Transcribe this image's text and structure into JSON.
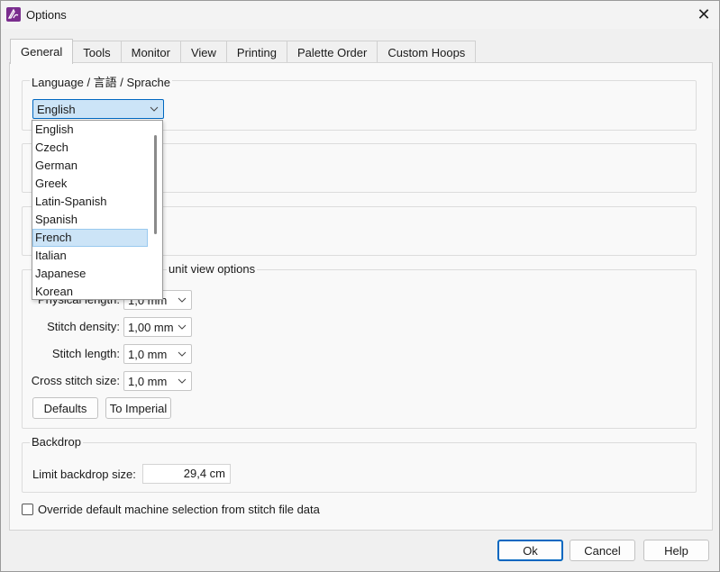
{
  "window": {
    "title": "Options"
  },
  "tabs": [
    "General",
    "Tools",
    "Monitor",
    "View",
    "Printing",
    "Palette Order",
    "Custom Hoops"
  ],
  "language": {
    "group_label": "Language / 言語 / Sprache",
    "selected": "English",
    "options": [
      "English",
      "Czech",
      "German",
      "Greek",
      "Latin-Spanish",
      "Spanish",
      "French",
      "Italian",
      "Japanese",
      "Korean"
    ],
    "highlighted": "French"
  },
  "units": {
    "group_label_partial": "unit view options",
    "physical_length": {
      "label": "Physical length:",
      "value": "1,0 mm"
    },
    "stitch_density": {
      "label": "Stitch density:",
      "value": "1,00 mm"
    },
    "stitch_length": {
      "label": "Stitch length:",
      "value": "1,0 mm"
    },
    "cross_stitch_size": {
      "label": "Cross stitch size:",
      "value": "1,0 mm"
    },
    "defaults_label": "Defaults",
    "to_imperial_label": "To Imperial"
  },
  "backdrop": {
    "group_label": "Backdrop",
    "limit_label": "Limit backdrop size:",
    "limit_value": "29,4 cm"
  },
  "override_label": "Override default machine selection from stitch file data",
  "footer": {
    "ok": "Ok",
    "cancel": "Cancel",
    "help": "Help"
  },
  "colors": {
    "accent": "#0067c0",
    "selection": "#cce4f7",
    "app_icon": "#7a2d8e"
  }
}
